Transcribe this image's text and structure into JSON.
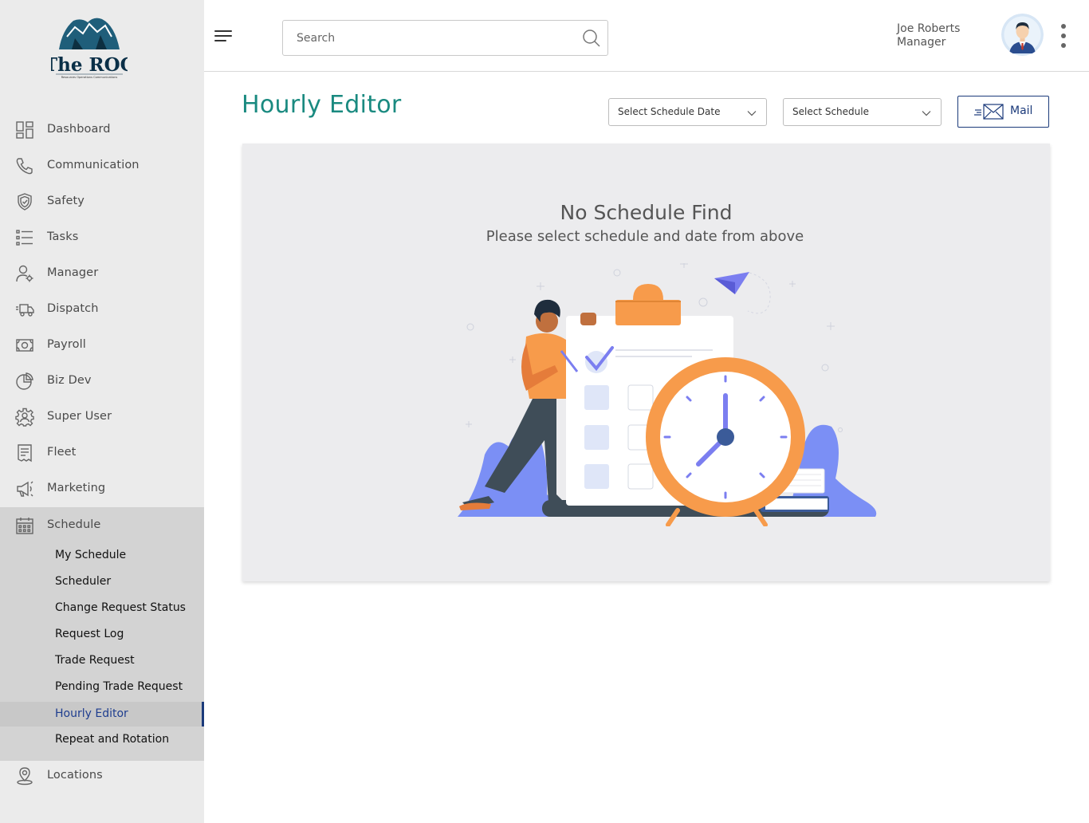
{
  "brand": {
    "logo_text": "The ROC",
    "logo_tagline": "Resources Operations Communications"
  },
  "sidebar": {
    "items": [
      {
        "label": "Dashboard",
        "icon": "dashboard-icon"
      },
      {
        "label": "Communication",
        "icon": "phone-icon"
      },
      {
        "label": "Safety",
        "icon": "shield-icon"
      },
      {
        "label": "Tasks",
        "icon": "list-icon"
      },
      {
        "label": "Manager",
        "icon": "manager-icon"
      },
      {
        "label": "Dispatch",
        "icon": "truck-icon"
      },
      {
        "label": "Payroll",
        "icon": "money-icon"
      },
      {
        "label": "Biz Dev",
        "icon": "pie-chart-icon"
      },
      {
        "label": "Super User",
        "icon": "gear-user-icon"
      },
      {
        "label": "Fleet",
        "icon": "receipt-icon"
      },
      {
        "label": "Marketing",
        "icon": "megaphone-icon"
      },
      {
        "label": "Schedule",
        "icon": "calendar-icon"
      }
    ],
    "schedule_subitems": [
      {
        "label": "My Schedule"
      },
      {
        "label": "Scheduler"
      },
      {
        "label": "Change Request Status"
      },
      {
        "label": "Request Log"
      },
      {
        "label": "Trade Request"
      },
      {
        "label": "Pending Trade Request"
      },
      {
        "label": "Hourly Editor",
        "active": true
      },
      {
        "label": "Repeat and Rotation"
      }
    ],
    "locations": {
      "label": "Locations",
      "icon": "location-pin-icon"
    }
  },
  "header": {
    "search_placeholder": "Search",
    "user_name": "Joe Roberts",
    "user_role": "Manager"
  },
  "main": {
    "title": "Hourly Editor",
    "date_select": "Select Schedule Date",
    "schedule_select": "Select Schedule",
    "mail_label": "Mail",
    "empty_title": "No Schedule Find",
    "empty_subtitle": "Please select schedule and date from above"
  },
  "colors": {
    "accent_teal": "#1a8a80",
    "navy": "#1b3a7a",
    "sidebar_bg": "#ebebeb",
    "schedule_bg": "#d3d3d3",
    "orange": "#f79b4b",
    "purple": "#7b7ef0"
  }
}
